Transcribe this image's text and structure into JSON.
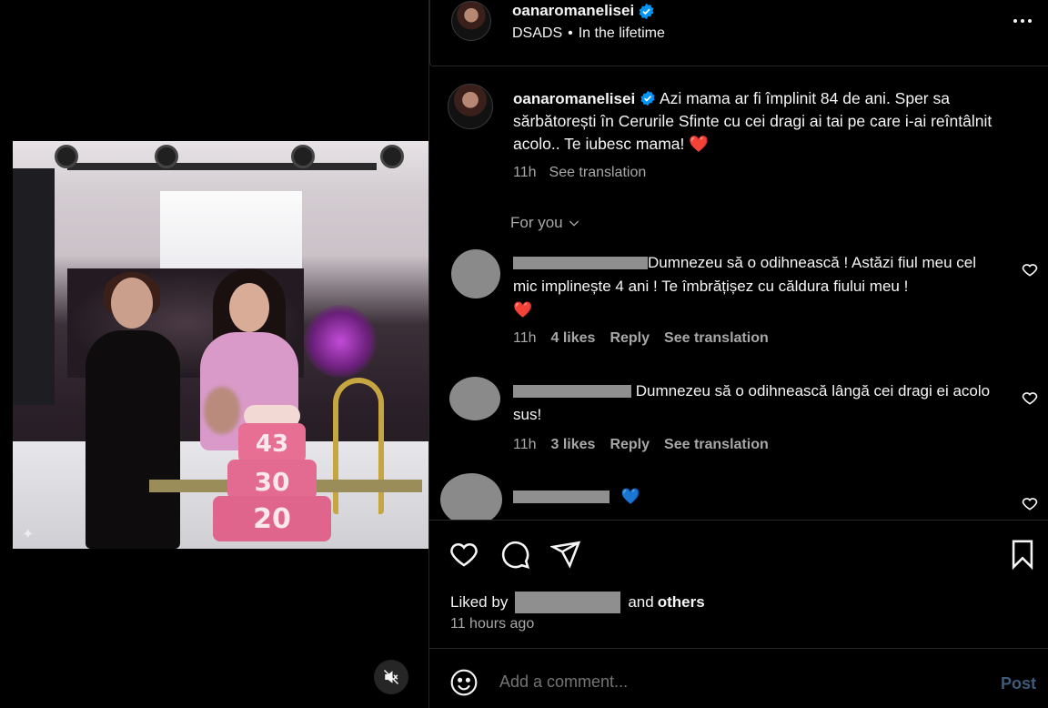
{
  "post": {
    "username": "oanaromanelisei",
    "subtitle_left": "DSADS",
    "subtitle_sep": "•",
    "subtitle_right": "In the lifetime",
    "caption_username": "oanaromanelisei",
    "caption_text": "Azi mama ar fi împlinit 84 de ani. Sper sa sărbătorești în Cerurile Sfinte cu cei dragi ai tai pe care i-ai reîntâlnit acolo.. Te iubesc mama!",
    "caption_emoji": "❤️",
    "caption_time": "11h",
    "caption_translate": "See translation",
    "cake_numbers": [
      "43",
      "30",
      "20"
    ]
  },
  "comments_filter": "For you",
  "comments": [
    {
      "text": "Dumnezeu să o odihnească ! Astăzi fiul meu cel mic implinește 4 ani ! Te îmbrățișez cu căldura fiului meu !",
      "emoji": "❤️",
      "time": "11h",
      "likes": "4 likes",
      "reply": "Reply",
      "translate": "See translation"
    },
    {
      "text": "Dumnezeu să o odihnească lângă cei dragi ei acolo sus!",
      "time": "11h",
      "likes": "3 likes",
      "reply": "Reply",
      "translate": "See translation"
    },
    {
      "emoji": "💙"
    }
  ],
  "likes": {
    "prefix": "Liked by",
    "and": "and",
    "others": "others",
    "time_ago": "11 hours ago"
  },
  "add_comment": {
    "placeholder": "Add a comment...",
    "post_label": "Post"
  },
  "colors": {
    "verified": "#0095f6",
    "post_button_disabled": "#3d5a7a",
    "heart": "#e0245e",
    "blue_heart": "#1d8cf8"
  },
  "icons": {
    "more": "more-horizontal-icon",
    "mute": "speaker-muted-icon",
    "like": "heart-outline-icon",
    "comment": "comment-bubble-icon",
    "share": "paper-plane-icon",
    "save": "bookmark-icon",
    "emoji": "smiley-icon"
  }
}
